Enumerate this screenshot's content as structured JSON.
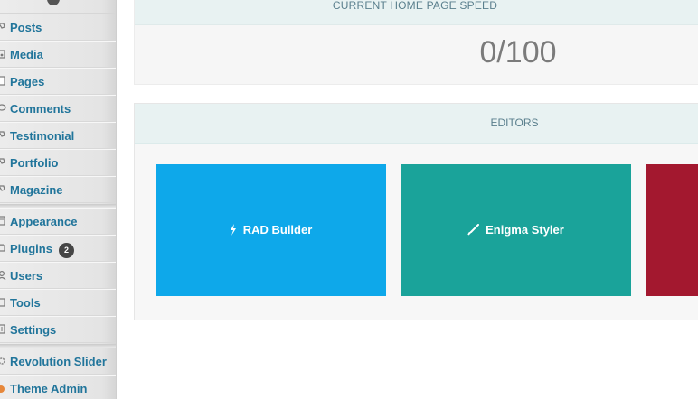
{
  "sidebar": {
    "items": [
      {
        "label": "Posts",
        "icon": "pushpin-icon"
      },
      {
        "label": "Media",
        "icon": "media-icon"
      },
      {
        "label": "Pages",
        "icon": "pages-icon"
      },
      {
        "label": "Comments",
        "icon": "comments-icon"
      },
      {
        "label": "Testimonial",
        "icon": "pushpin-icon"
      },
      {
        "label": "Portfolio",
        "icon": "pushpin-icon"
      },
      {
        "label": "Magazine",
        "icon": "pushpin-icon"
      },
      {
        "label": "Appearance",
        "icon": "appearance-icon"
      },
      {
        "label": "Plugins",
        "icon": "plugin-icon",
        "badge": "2"
      },
      {
        "label": "Users",
        "icon": "users-icon"
      },
      {
        "label": "Tools",
        "icon": "tools-icon"
      },
      {
        "label": "Settings",
        "icon": "settings-icon"
      },
      {
        "label": "Revolution Slider",
        "icon": "gear-icon"
      },
      {
        "label": "Theme Admin",
        "icon": "theme-admin-icon"
      }
    ],
    "accent_color": "#21759b"
  },
  "speed_panel": {
    "title": "CURRENT HOME PAGE SPEED",
    "value": "0/100"
  },
  "editors_panel": {
    "title": "EDITORS",
    "tiles": [
      {
        "label": "RAD Builder",
        "icon": "lightning-icon",
        "color": "#0ea8ea"
      },
      {
        "label": "Enigma Styler",
        "icon": "brush-icon",
        "color": "#1aa39a"
      },
      {
        "label": "",
        "icon": "",
        "color": "#a3182f"
      }
    ]
  }
}
